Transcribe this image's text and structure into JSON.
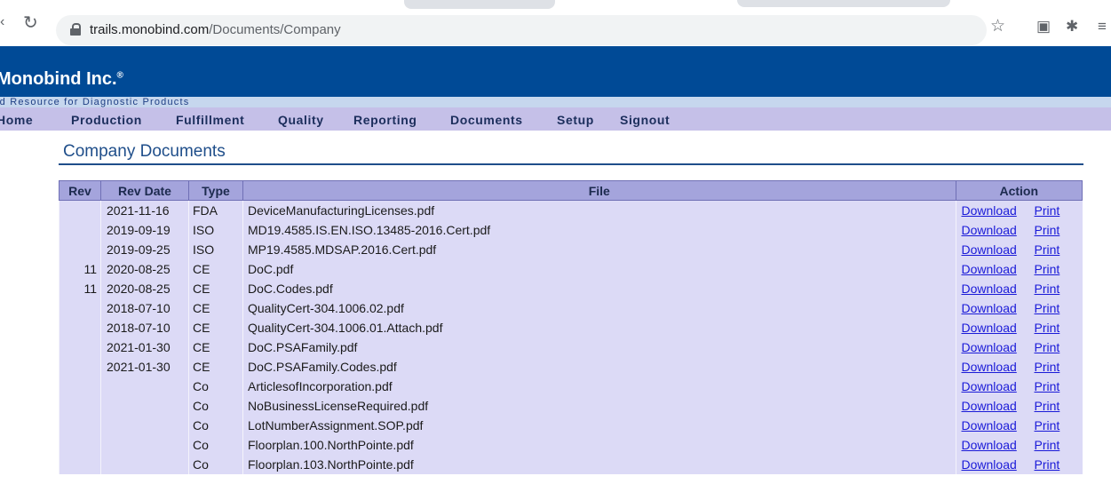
{
  "browser": {
    "url_host": "trails.monobind.com",
    "url_path": "/Documents/Company",
    "back_icon": "chevron-left-icon",
    "reload_icon": "reload-icon"
  },
  "site": {
    "brand": "Monobind Inc.",
    "brand_mark": "®",
    "tagline": "ld Resource for Diagnostic Products"
  },
  "nav": [
    "Home",
    "Production",
    "Fulfillment",
    "Quality",
    "Reporting",
    "Documents",
    "Setup",
    "Signout"
  ],
  "page": {
    "title": "Company Documents"
  },
  "table": {
    "headers": {
      "rev": "Rev",
      "rev_date": "Rev Date",
      "type": "Type",
      "file": "File",
      "action": "Action"
    },
    "download_label": "Download",
    "print_label": "Print",
    "rows": [
      {
        "rev": "",
        "date": "2021-11-16",
        "type": "FDA",
        "file": "DeviceManufacturingLicenses.pdf"
      },
      {
        "rev": "",
        "date": "2019-09-19",
        "type": "ISO",
        "file": "MD19.4585.IS.EN.ISO.13485-2016.Cert.pdf"
      },
      {
        "rev": "",
        "date": "2019-09-25",
        "type": "ISO",
        "file": "MP19.4585.MDSAP.2016.Cert.pdf"
      },
      {
        "rev": "11",
        "date": "2020-08-25",
        "type": "CE",
        "file": "DoC.pdf"
      },
      {
        "rev": "11",
        "date": "2020-08-25",
        "type": "CE",
        "file": "DoC.Codes.pdf"
      },
      {
        "rev": "",
        "date": "2018-07-10",
        "type": "CE",
        "file": "QualityCert-304.1006.02.pdf"
      },
      {
        "rev": "",
        "date": "2018-07-10",
        "type": "CE",
        "file": "QualityCert-304.1006.01.Attach.pdf"
      },
      {
        "rev": "",
        "date": "2021-01-30",
        "type": "CE",
        "file": "DoC.PSAFamily.pdf"
      },
      {
        "rev": "",
        "date": "2021-01-30",
        "type": "CE",
        "file": "DoC.PSAFamily.Codes.pdf"
      },
      {
        "rev": "",
        "date": "",
        "type": "Co",
        "file": "ArticlesofIncorporation.pdf"
      },
      {
        "rev": "",
        "date": "",
        "type": "Co",
        "file": "NoBusinessLicenseRequired.pdf"
      },
      {
        "rev": "",
        "date": "",
        "type": "Co",
        "file": "LotNumberAssignment.SOP.pdf"
      },
      {
        "rev": "",
        "date": "",
        "type": "Co",
        "file": "Floorplan.100.NorthPointe.pdf"
      },
      {
        "rev": "",
        "date": "",
        "type": "Co",
        "file": "Floorplan.103.NorthPointe.pdf"
      }
    ]
  },
  "colors": {
    "banner": "#004a96",
    "nav_bg": "#c5c0e8",
    "header_bg": "#a4a4dc",
    "row_bg": "#dcdaf6",
    "link": "#1a1ad8"
  }
}
